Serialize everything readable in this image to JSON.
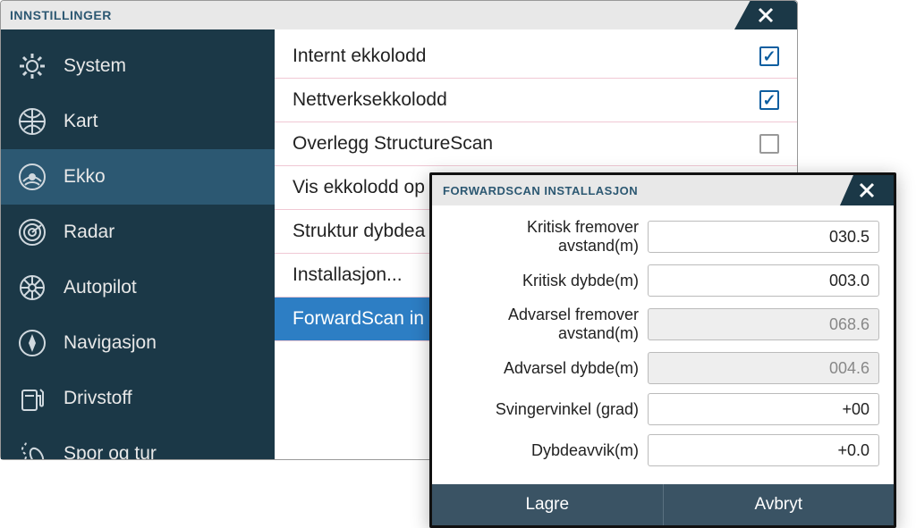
{
  "window": {
    "title": "INNSTILLINGER"
  },
  "sidebar": {
    "items": [
      {
        "label": "System",
        "icon": "gear"
      },
      {
        "label": "Kart",
        "icon": "globe"
      },
      {
        "label": "Ekko",
        "icon": "sonar",
        "selected": true
      },
      {
        "label": "Radar",
        "icon": "radar"
      },
      {
        "label": "Autopilot",
        "icon": "wheel"
      },
      {
        "label": "Navigasjon",
        "icon": "compass"
      },
      {
        "label": "Drivstoff",
        "icon": "fuel"
      },
      {
        "label": "Spor og tur",
        "icon": "track"
      }
    ]
  },
  "content": {
    "items": [
      {
        "label": "Internt ekkolodd",
        "checked": true
      },
      {
        "label": "Nettverksekkolodd",
        "checked": true
      },
      {
        "label": "Overlegg StructureScan",
        "checked": false
      },
      {
        "label": "Vis ekkolodd op"
      },
      {
        "label": "Struktur dybdea"
      },
      {
        "label": "Installasjon..."
      },
      {
        "label": "ForwardScan in",
        "selected": true
      }
    ]
  },
  "modal": {
    "title": "FORWARDSCAN INSTALLASJON",
    "fields": [
      {
        "label": "Kritisk fremover avstand(m)",
        "value": "030.5",
        "disabled": false
      },
      {
        "label": "Kritisk dybde(m)",
        "value": "003.0",
        "disabled": false
      },
      {
        "label": "Advarsel fremover avstand(m)",
        "value": "068.6",
        "disabled": true
      },
      {
        "label": "Advarsel dybde(m)",
        "value": "004.6",
        "disabled": true
      },
      {
        "label": "Svingervinkel (grad)",
        "value": "+00",
        "disabled": false
      },
      {
        "label": "Dybdeavvik(m)",
        "value": "+0.0",
        "disabled": false
      }
    ],
    "buttons": {
      "save": "Lagre",
      "cancel": "Avbryt"
    }
  }
}
